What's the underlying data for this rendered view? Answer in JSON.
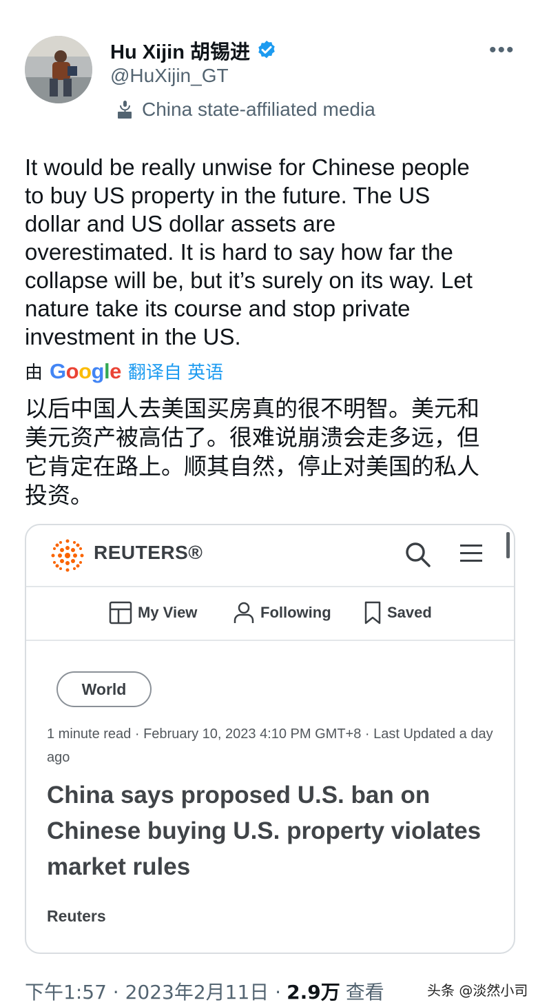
{
  "author": {
    "name": "Hu Xijin 胡锡进",
    "handle": "@HuXijin_GT",
    "label": "China state-affiliated media",
    "verified_color": "#1d9bf0"
  },
  "tweet": {
    "text": "It would be really unwise for Chinese people\nto buy US property in the future. The US\ndollar and US dollar assets are\noverestimated. It is hard to say how far the\ncollapse will be, but it’s surely on its way. Let\nnature take its course and stop private\ninvestment in the US.",
    "translation_by": "由",
    "translation_provider": {
      "g1": "G",
      "o1": "o",
      "o2": "o",
      "g2": "g",
      "l": "l",
      "e": "e"
    },
    "translated_from": "翻译自 英语",
    "translated_text": "以后中国人去美国买房真的很不明智。美元和\n美元资产被高估了。很难说崩溃会走多远，但\n它肯定在路上。顺其自然，停止对美国的私人\n投资。"
  },
  "card": {
    "brand": "REUTERS®",
    "nav": {
      "my_view": "My View",
      "following": "Following",
      "saved": "Saved"
    },
    "tag": "World",
    "meta": "1 minute read · February 10, 2023 4:10 PM GMT+8 · Last Updated a day ago",
    "headline": "China says proposed U.S. ban on Chinese buying U.S. property violates market rules",
    "byline": "Reuters",
    "accent_color": "#fa6400"
  },
  "footer": {
    "time": "下午1:57 · 2023年2月11日 ·",
    "views": "2.9万",
    "views_label": "查看"
  },
  "watermark": "头条 @淡然小司"
}
